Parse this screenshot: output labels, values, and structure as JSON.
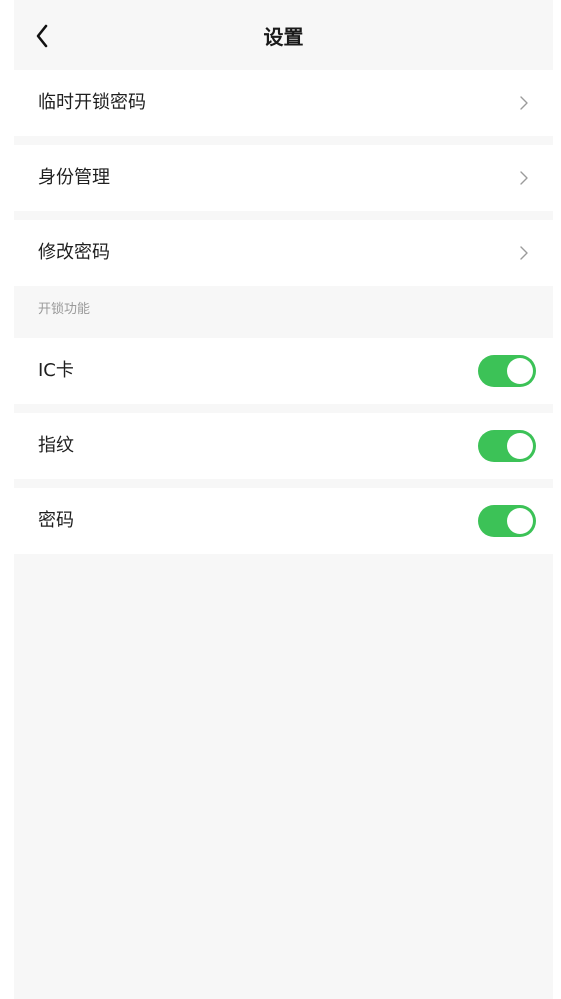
{
  "header": {
    "title": "设置",
    "back_icon": "chevron-left-icon"
  },
  "menu": [
    {
      "label": "临时开锁密码",
      "icon": "chevron-right-icon"
    },
    {
      "label": "身份管理",
      "icon": "chevron-right-icon"
    },
    {
      "label": "修改密码",
      "icon": "chevron-right-icon"
    }
  ],
  "unlock_section": {
    "title": "开锁功能",
    "items": [
      {
        "label": "IC卡",
        "enabled": true
      },
      {
        "label": "指纹",
        "enabled": true
      },
      {
        "label": "密码",
        "enabled": true
      }
    ]
  },
  "colors": {
    "toggle_on": "#3cc257",
    "background": "#f7f7f7",
    "row_background": "#ffffff"
  }
}
